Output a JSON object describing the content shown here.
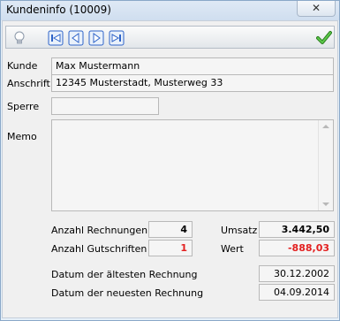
{
  "window": {
    "title": "Kundeninfo (10009)",
    "close_label": "✕"
  },
  "toolbar": {
    "buttons": [
      "lightbulb-icon",
      "first-record-icon",
      "previous-record-icon",
      "next-record-icon",
      "last-record-icon"
    ],
    "confirm_icon": "checkmark-icon",
    "accent_color": "#2f64c8",
    "confirm_color": "#3aa32b"
  },
  "form": {
    "kunde_label": "Kunde",
    "kunde_value": "Max Mustermann",
    "anschrift_label": "Anschrift",
    "anschrift_value": "12345 Musterstadt, Musterweg 33",
    "sperre_label": "Sperre",
    "sperre_value": "",
    "memo_label": "Memo",
    "memo_value": ""
  },
  "stats": {
    "rechnungen_label": "Anzahl Rechnungen",
    "rechnungen_value": "4",
    "gutschriften_label": "Anzahl Gutschriften",
    "gutschriften_value": "1",
    "umsatz_label": "Umsatz",
    "umsatz_value": "3.442,50",
    "wert_label": "Wert",
    "wert_value": "-888,03",
    "negative_color": "#e32020"
  },
  "dates": {
    "oldest_label": "Datum der ältesten Rechnung",
    "oldest_value": "30.12.2002",
    "newest_label": "Datum der neuesten Rechnung",
    "newest_value": "04.09.2014"
  }
}
